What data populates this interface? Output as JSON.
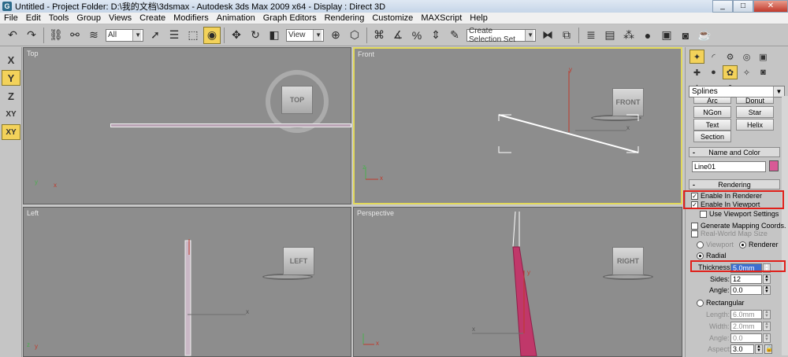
{
  "window": {
    "title": "Untitled   - Project Folder: D:\\我的文档\\3dsmax    - Autodesk 3ds Max  2009 x64     - Display : Direct 3D",
    "app_icon": "G",
    "minimize": "_",
    "maximize": "□",
    "close": "✕"
  },
  "menu": [
    "File",
    "Edit",
    "Tools",
    "Group",
    "Views",
    "Create",
    "Modifiers",
    "Animation",
    "Graph Editors",
    "Rendering",
    "Customize",
    "MAXScript",
    "Help"
  ],
  "toolbar": {
    "filter_select": "All",
    "ref_coord_select": "View",
    "selection_set": "Create Selection Set"
  },
  "axis_buttons": [
    "X",
    "Y",
    "Z",
    "XY",
    "XY"
  ],
  "viewports": {
    "top": {
      "label": "Top",
      "cube": "TOP"
    },
    "front": {
      "label": "Front",
      "cube": "FRONT"
    },
    "left": {
      "label": "Left",
      "cube": "LEFT"
    },
    "perspective": {
      "label": "Perspective",
      "cube": "RIGHT"
    }
  },
  "axis_labels": {
    "x": "x",
    "y": "y",
    "z": "z"
  },
  "command_panel": {
    "category": "Splines",
    "buttons": {
      "arc": "Arc",
      "donut": "Donut",
      "ngon": "NGon",
      "star": "Star",
      "text": "Text",
      "helix": "Helix",
      "section": "Section"
    },
    "name_color_title": "Name and Color",
    "object_name": "Line01",
    "object_color": "#d85a96",
    "rendering_title": "Rendering",
    "enable_renderer": "Enable In Renderer",
    "enable_viewport": "Enable In Viewport",
    "use_viewport_settings": "Use Viewport Settings",
    "gen_mapping": "Generate Mapping Coords.",
    "real_world": "Real-World Map Size",
    "viewport_opt": "Viewport",
    "renderer_opt": "Renderer",
    "radial": "Radial",
    "thickness_label": "Thickness:",
    "thickness_value": "5.0mm",
    "sides_label": "Sides:",
    "sides_value": "12",
    "angle_label": "Angle:",
    "angle_value": "0.0",
    "rectangular": "Rectangular",
    "length_label": "Length:",
    "length_value": "6.0mm",
    "width_label": "Width:",
    "width_value": "2.0mm",
    "angle2_label": "Angle:",
    "angle2_value": "0.0",
    "aspect_label": "Aspect:",
    "aspect_value": "3.0"
  },
  "colors": {
    "highlight": "#f3d25a",
    "red_annotation": "#e0201a",
    "viewport_bg": "#8d8d8d",
    "spline_pink": "#c0386a"
  }
}
